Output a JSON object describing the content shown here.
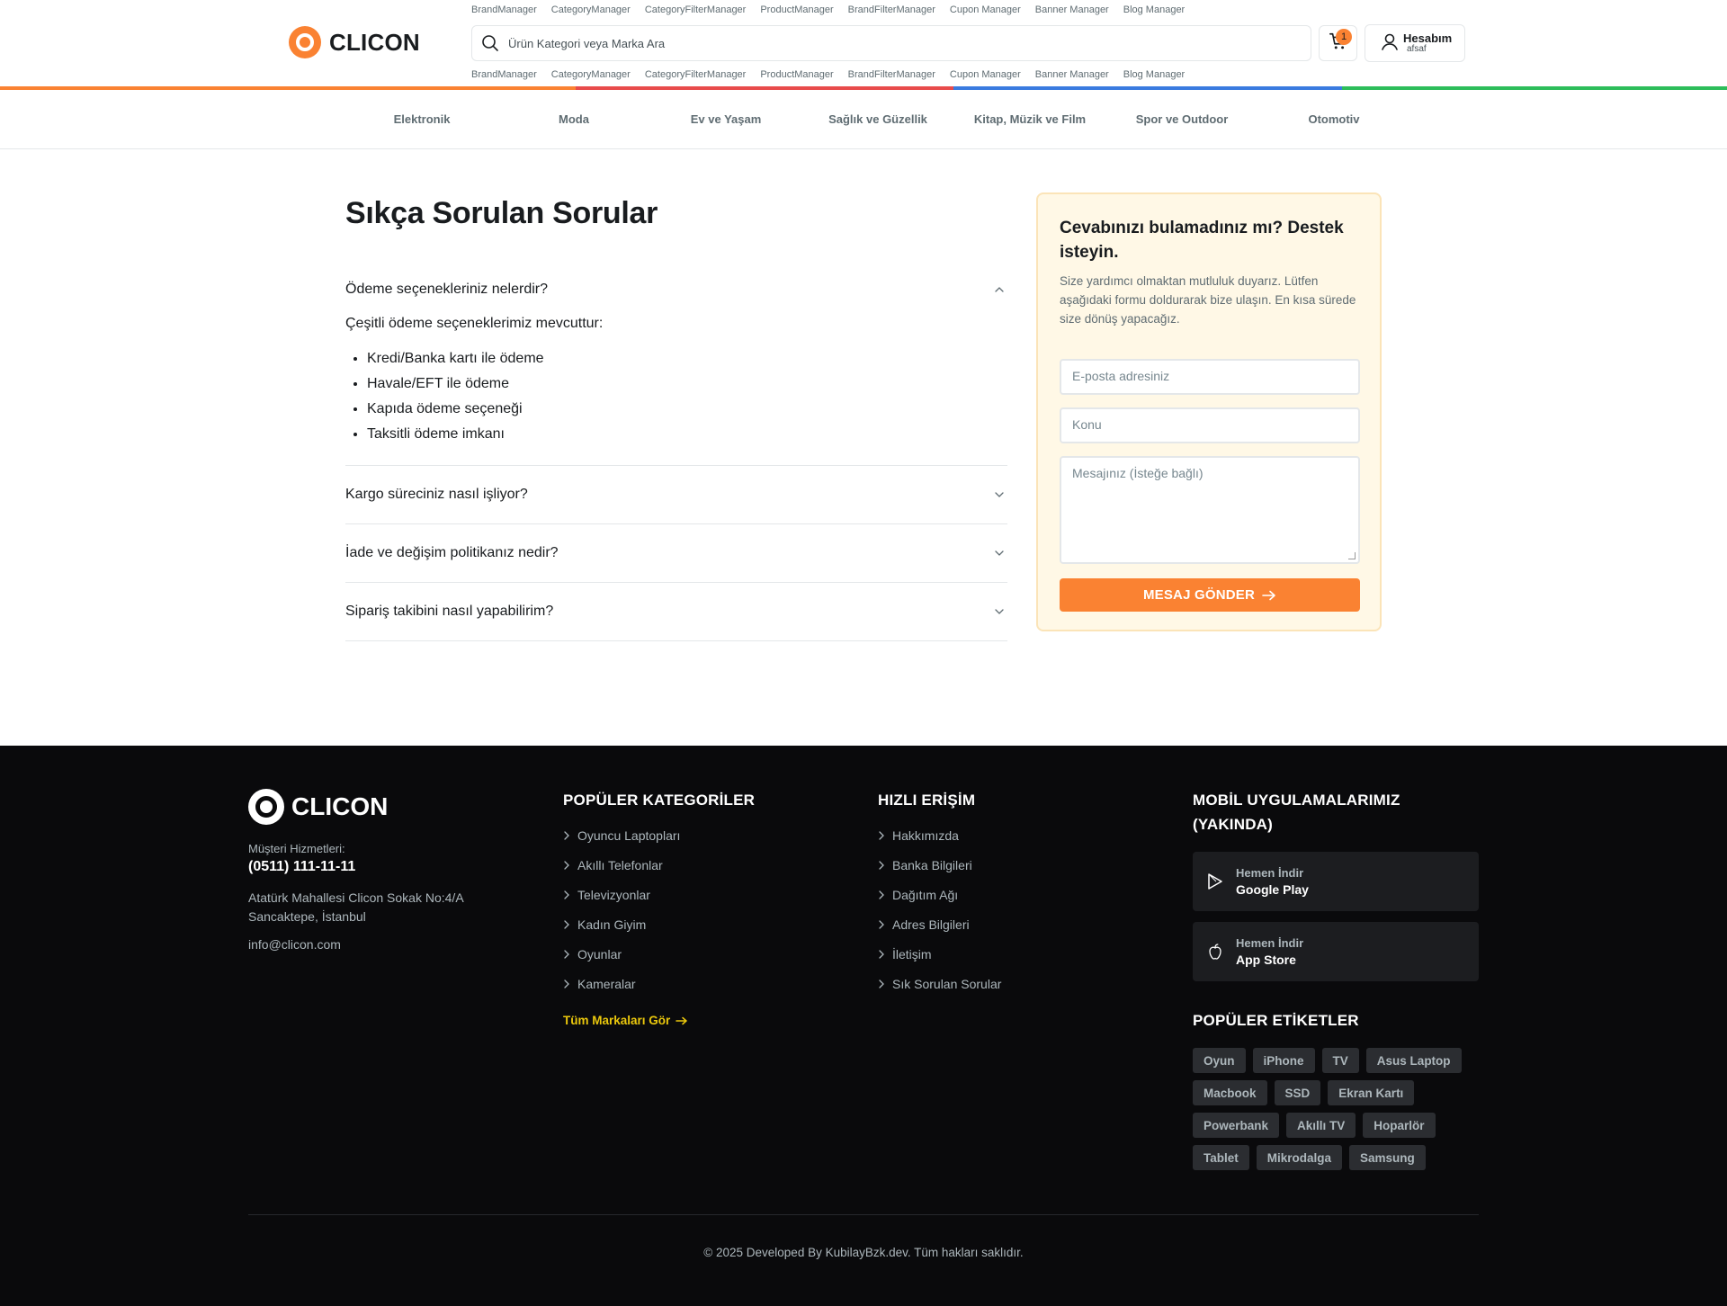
{
  "admin_links": [
    "BrandManager",
    "CategoryManager",
    "CategoryFilterManager",
    "ProductManager",
    "BrandFilterManager",
    "Cupon Manager",
    "Banner Manager",
    "Blog Manager"
  ],
  "header": {
    "logo_text": "CLICON",
    "search_placeholder": "Ürün Kategori veya Marka Ara",
    "cart_count": "1",
    "account_title": "Hesabım",
    "account_user": "afsaf"
  },
  "color_bar": [
    "#fa8232",
    "#e84b4b",
    "#3a7be0",
    "#2dbd5a"
  ],
  "categories": [
    "Elektronik",
    "Moda",
    "Ev ve Yaşam",
    "Sağlık ve Güzellik",
    "Kitap, Müzik ve Film",
    "Spor ve Outdoor",
    "Otomotiv"
  ],
  "faq": {
    "title": "Sıkça Sorulan Sorular",
    "items": [
      {
        "question": "Ödeme seçenekleriniz nelerdir?",
        "expanded": true,
        "answer_intro": "Çeşitli ödeme seçeneklerimiz mevcuttur:",
        "answer_points": [
          "Kredi/Banka kartı ile ödeme",
          "Havale/EFT ile ödeme",
          "Kapıda ödeme seçeneği",
          "Taksitli ödeme imkanı"
        ]
      },
      {
        "question": "Kargo süreciniz nasıl işliyor?",
        "expanded": false
      },
      {
        "question": "İade ve değişim politikanız nedir?",
        "expanded": false
      },
      {
        "question": "Sipariş takibini nasıl yapabilirim?",
        "expanded": false
      }
    ]
  },
  "support": {
    "title": "Cevabınızı bulamadınız mı? Destek isteyin.",
    "description": "Size yardımcı olmaktan mutluluk duyarız. Lütfen aşağıdaki formu doldurarak bize ulaşın. En kısa sürede size dönüş yapacağız.",
    "email_placeholder": "E-posta adresiniz",
    "subject_placeholder": "Konu",
    "message_placeholder": "Mesajınız (İsteğe bağlı)",
    "send_label": "MESAJ GÖNDER",
    "accent": "#fa8232"
  },
  "footer": {
    "logo_text": "CLICON",
    "contact_label": "Müşteri Hizmetleri:",
    "phone": "(0511) 111-11-11",
    "address": "Atatürk Mahallesi Clicon Sokak No:4/A Sancaktepe, İstanbul",
    "email": "info@clicon.com",
    "popular_categories": {
      "heading": "POPÜLER KATEGORİLER",
      "items": [
        "Oyuncu Laptopları",
        "Akıllı Telefonlar",
        "Televizyonlar",
        "Kadın Giyim",
        "Oyunlar",
        "Kameralar"
      ],
      "all_brands": "Tüm Markaları Gör"
    },
    "quick_access": {
      "heading": "HIZLI ERİŞİM",
      "items": [
        "Hakkımızda",
        "Banka Bilgileri",
        "Dağıtım Ağı",
        "Adres Bilgileri",
        "İletişim",
        "Sık Sorulan Sorular"
      ]
    },
    "mobile_apps": {
      "heading": "MOBİL UYGULAMALARIMIZ (YAKINDA)",
      "google": {
        "small": "Hemen İndir",
        "big": "Google Play",
        "icon": "play-icon"
      },
      "apple": {
        "small": "Hemen İndir",
        "big": "App Store",
        "icon": "apple-icon"
      }
    },
    "popular_tags": {
      "heading": "POPÜLER ETİKETLER",
      "items": [
        "Oyun",
        "iPhone",
        "TV",
        "Asus Laptop",
        "Macbook",
        "SSD",
        "Ekran Kartı",
        "Powerbank",
        "Akıllı TV",
        "Hoparlör",
        "Tablet",
        "Mikrodalga",
        "Samsung"
      ]
    },
    "copyright": "© 2025 Developed By KubilayBzk.dev. Tüm hakları saklıdır."
  }
}
